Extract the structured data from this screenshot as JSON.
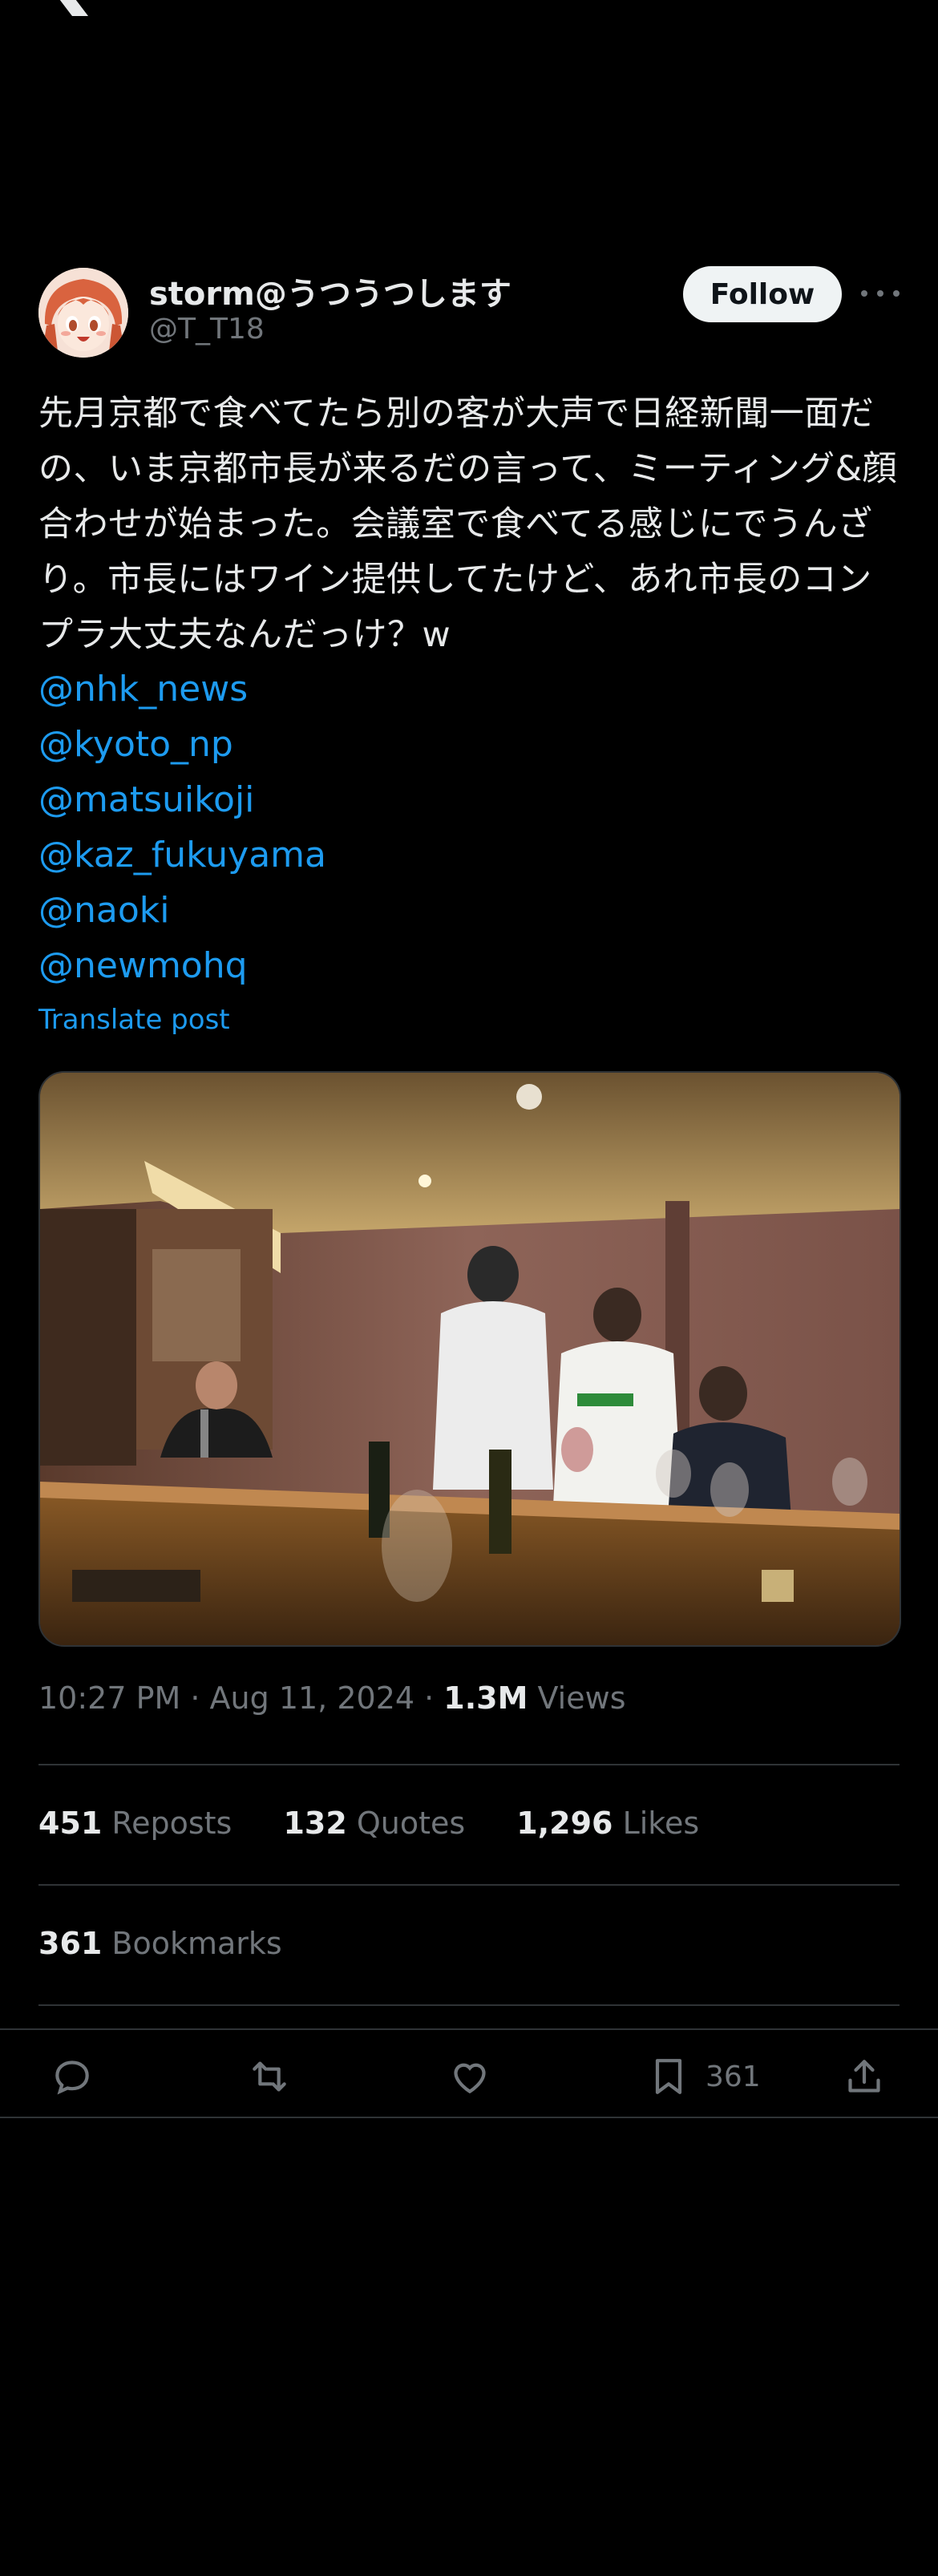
{
  "app": {
    "logo_icon": "x-logo-icon"
  },
  "author": {
    "display_name": "storm@うつうつします",
    "handle": "@T_T18",
    "follow_label": "Follow"
  },
  "tweet": {
    "text": "先月京都で食べてたら別の客が大声で日経新聞一面だの、いま京都市長が来るだの言って、ミーティング&顔合わせが始まった。会議室で食べてる感じにでうんざり。市長にはワイン提供してたけど、あれ市長のコンプラ大丈夫なんだっけ？w",
    "mentions": [
      "@nhk_news",
      "@kyoto_np",
      "@matsuikoji",
      "@kaz_fukuyama",
      "@naoki",
      "@newmohq"
    ],
    "translate_label": "Translate post"
  },
  "meta": {
    "time": "10:27 PM",
    "sep1": " · ",
    "date": "Aug 11, 2024",
    "sep2": " · ",
    "views_count": "1.3M",
    "views_label": " Views"
  },
  "stats": {
    "reposts_count": "451",
    "reposts_label": " Reposts",
    "quotes_count": "132",
    "quotes_label": " Quotes",
    "likes_count": "1,296",
    "likes_label": " Likes",
    "bookmarks_count": "361",
    "bookmarks_label": " Bookmarks"
  },
  "actions": {
    "reply_icon": "reply-icon",
    "repost_icon": "repost-icon",
    "like_icon": "heart-icon",
    "bookmark_icon": "bookmark-icon",
    "bookmark_count": "361",
    "share_icon": "share-icon"
  },
  "colors": {
    "background": "#000000",
    "text": "#e7e9ea",
    "secondary": "#71767b",
    "link": "#1d9bf0",
    "divider": "#2f3336"
  }
}
